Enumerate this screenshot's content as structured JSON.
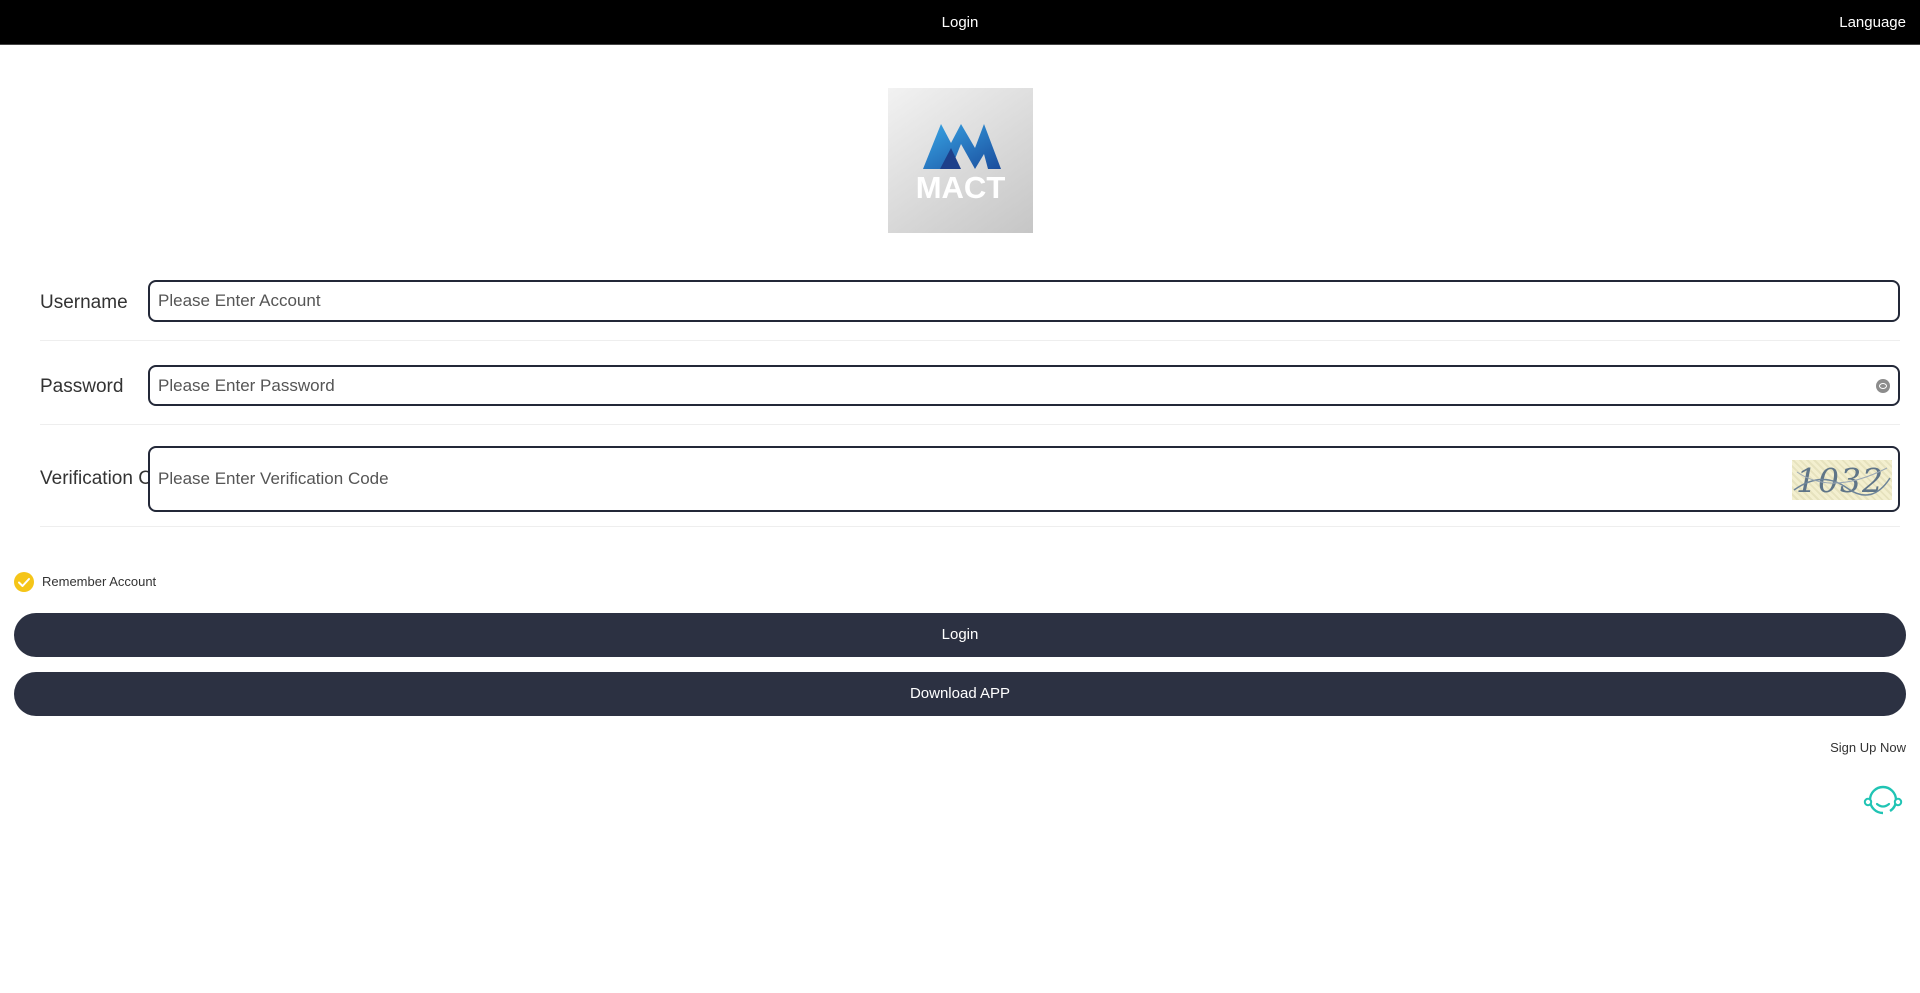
{
  "header": {
    "title": "Login",
    "language_label": "Language"
  },
  "logo": {
    "text": "MACT"
  },
  "form": {
    "username": {
      "label": "Username",
      "placeholder": "Please Enter Account",
      "value": ""
    },
    "password": {
      "label": "Password",
      "placeholder": "Please Enter Password",
      "value": ""
    },
    "verification": {
      "label": "Verification Code",
      "placeholder": "Please Enter Verification Code",
      "value": "",
      "captcha_text": "1032"
    },
    "remember": {
      "label": "Remember Account",
      "checked": true
    }
  },
  "buttons": {
    "login_label": "Login",
    "download_label": "Download APP"
  },
  "links": {
    "signup_label": "Sign Up Now"
  },
  "icons": {
    "eye": "eye-icon",
    "check": "check-icon",
    "support": "headset-icon"
  },
  "colors": {
    "header_bg": "#000000",
    "button_bg": "#2c3142",
    "check": "#f5c518",
    "support_icon": "#20c4b4",
    "logo_blue": "#2a7fc9"
  }
}
